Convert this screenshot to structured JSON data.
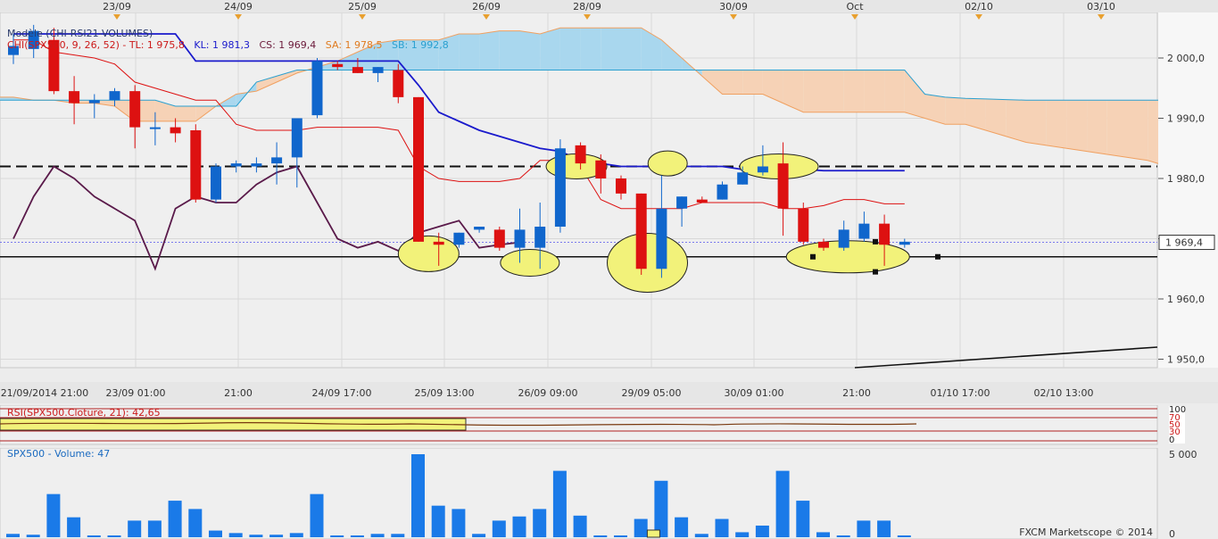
{
  "header": {
    "title_parts": [
      {
        "text": "Modèle (CHI-RSI21-VOLUMES)",
        "color": "#2a3a6a"
      },
      {
        "text": "CHI(SPX500, 9, 26, 52) -  TL: 1 975,8",
        "color": "#cc1a1a"
      },
      {
        "text": "KL: 1 981,3",
        "color": "#1a1acc"
      },
      {
        "text": "CS: 1 969,4",
        "color": "#6b1a3a"
      },
      {
        "text": "SA: 1 978,5",
        "color": "#e07b20"
      },
      {
        "text": "SB: 1 992,8",
        "color": "#2aa0d0"
      }
    ]
  },
  "top_axis_labels": [
    "23/09",
    "24/09",
    "25/09",
    "26/09",
    "28/09",
    "30/09",
    "Oct",
    "02/10",
    "03/10"
  ],
  "bottom_axis_labels": [
    "21/09/2014 21:00",
    "23/09 01:00",
    "21:00",
    "24/09 17:00",
    "25/09 13:00",
    "26/09 09:00",
    "29/09 05:00",
    "30/09 01:00",
    "21:00",
    "01/10 17:00",
    "02/10 13:00"
  ],
  "price_axis_ticks": [
    "2 000,0",
    "1 990,0",
    "1 980,0",
    "1 970,0",
    "1 960,0",
    "1 950,0"
  ],
  "current_price_label": "1 969,4",
  "rsi_panel": {
    "title": "RSI(SPX500.Cloture, 21): 42,65",
    "ticks": [
      "100",
      "70",
      "50",
      "30",
      "0"
    ]
  },
  "volume_panel": {
    "title": "SPX500 - Volume: 47",
    "ticks": [
      "5 000",
      "0"
    ],
    "footer": "FXCM Marketscope © 2014"
  },
  "colors": {
    "bull": "#1066cc",
    "bear": "#dd1111",
    "tenkan": "#dd1111",
    "kijun": "#1a1acc",
    "chikou": "#5a1a4a",
    "kumo_bull": "#a9d7ee",
    "kumo_bear": "#f6d2b6",
    "highlight": "#f2f27a"
  },
  "chart_data": {
    "type": "candlestick",
    "instrument": "SPX500",
    "price_range": [
      1947,
      2005
    ],
    "candles": [
      {
        "o": 2000.5,
        "h": 2004.0,
        "l": 1999.0,
        "c": 2002.0
      },
      {
        "o": 2001.5,
        "h": 2005.5,
        "l": 2000.0,
        "c": 2004.5
      },
      {
        "o": 2003.0,
        "h": 2005.0,
        "l": 1994.0,
        "c": 1994.5
      },
      {
        "o": 1994.5,
        "h": 1997.0,
        "l": 1989.0,
        "c": 1992.5
      },
      {
        "o": 1992.5,
        "h": 1994.0,
        "l": 1990.0,
        "c": 1993.0
      },
      {
        "o": 1993.0,
        "h": 1995.0,
        "l": 1992.0,
        "c": 1994.5
      },
      {
        "o": 1994.5,
        "h": 1995.5,
        "l": 1985.0,
        "c": 1988.5
      },
      {
        "o": 1988.5,
        "h": 1991.0,
        "l": 1985.5,
        "c": 1988.5
      },
      {
        "o": 1988.5,
        "h": 1990.0,
        "l": 1986.0,
        "c": 1987.5
      },
      {
        "o": 1988.0,
        "h": 1989.0,
        "l": 1976.0,
        "c": 1976.5
      },
      {
        "o": 1976.5,
        "h": 1982.5,
        "l": 1976.0,
        "c": 1982.0
      },
      {
        "o": 1982.0,
        "h": 1983.0,
        "l": 1981.0,
        "c": 1982.5
      },
      {
        "o": 1982.0,
        "h": 1983.5,
        "l": 1981.0,
        "c": 1982.5
      },
      {
        "o": 1982.5,
        "h": 1986.0,
        "l": 1979.0,
        "c": 1983.5
      },
      {
        "o": 1983.5,
        "h": 1990.0,
        "l": 1978.5,
        "c": 1990.0
      },
      {
        "o": 1990.5,
        "h": 2000.0,
        "l": 1990.0,
        "c": 1999.5
      },
      {
        "o": 1999.0,
        "h": 1999.5,
        "l": 1998.0,
        "c": 1998.5
      },
      {
        "o": 1998.5,
        "h": 2000.0,
        "l": 1997.5,
        "c": 1997.5
      },
      {
        "o": 1997.5,
        "h": 1998.5,
        "l": 1996.0,
        "c": 1998.5
      },
      {
        "o": 1998.0,
        "h": 1999.0,
        "l": 1992.5,
        "c": 1993.5
      },
      {
        "o": 1993.5,
        "h": 1993.5,
        "l": 1969.5,
        "c": 1969.5
      },
      {
        "o": 1969.5,
        "h": 1971.0,
        "l": 1965.5,
        "c": 1969.0
      },
      {
        "o": 1969.0,
        "h": 1971.0,
        "l": 1968.5,
        "c": 1971.0
      },
      {
        "o": 1971.5,
        "h": 1972.0,
        "l": 1971.0,
        "c": 1972.0
      },
      {
        "o": 1971.5,
        "h": 1972.0,
        "l": 1968.0,
        "c": 1968.5
      },
      {
        "o": 1968.5,
        "h": 1975.0,
        "l": 1966.0,
        "c": 1971.5
      },
      {
        "o": 1968.5,
        "h": 1976.0,
        "l": 1965.0,
        "c": 1972.0
      },
      {
        "o": 1972.0,
        "h": 1986.5,
        "l": 1971.0,
        "c": 1985.0
      },
      {
        "o": 1985.5,
        "h": 1986.0,
        "l": 1981.5,
        "c": 1982.5
      },
      {
        "o": 1983.0,
        "h": 1984.0,
        "l": 1977.5,
        "c": 1980.0
      },
      {
        "o": 1980.0,
        "h": 1980.5,
        "l": 1976.5,
        "c": 1977.5
      },
      {
        "o": 1977.5,
        "h": 1977.5,
        "l": 1964.0,
        "c": 1965.0
      },
      {
        "o": 1965.0,
        "h": 1980.5,
        "l": 1963.5,
        "c": 1975.0
      },
      {
        "o": 1975.0,
        "h": 1977.0,
        "l": 1972.0,
        "c": 1977.0
      },
      {
        "o": 1976.5,
        "h": 1977.0,
        "l": 1976.0,
        "c": 1976.0
      },
      {
        "o": 1976.5,
        "h": 1979.5,
        "l": 1976.5,
        "c": 1979.0
      },
      {
        "o": 1979.0,
        "h": 1982.0,
        "l": 1979.0,
        "c": 1981.0
      },
      {
        "o": 1981.0,
        "h": 1985.5,
        "l": 1980.5,
        "c": 1982.0
      },
      {
        "o": 1982.5,
        "h": 1986.0,
        "l": 1970.5,
        "c": 1975.0
      },
      {
        "o": 1975.0,
        "h": 1976.0,
        "l": 1969.0,
        "c": 1969.5
      },
      {
        "o": 1969.5,
        "h": 1970.0,
        "l": 1968.0,
        "c": 1968.5
      },
      {
        "o": 1968.5,
        "h": 1973.0,
        "l": 1968.0,
        "c": 1971.5
      },
      {
        "o": 1970.0,
        "h": 1974.5,
        "l": 1969.5,
        "c": 1972.5
      },
      {
        "o": 1972.5,
        "h": 1974.0,
        "l": 1965.5,
        "c": 1969.0
      },
      {
        "o": 1969.0,
        "h": 1970.0,
        "l": 1968.5,
        "c": 1969.5
      }
    ],
    "volume_max": 5000,
    "volumes": [
      200,
      150,
      2600,
      1200,
      100,
      100,
      1000,
      1000,
      2200,
      1700,
      400,
      250,
      150,
      150,
      250,
      2600,
      100,
      100,
      200,
      200,
      5000,
      1900,
      1700,
      200,
      1000,
      1250,
      1700,
      4000,
      1300,
      100,
      100,
      1100,
      3400,
      1200,
      200,
      1100,
      300,
      700,
      4000,
      2200,
      300,
      100,
      1000,
      1000,
      50
    ],
    "kijun": [
      2004,
      2004,
      2004,
      2004,
      2004,
      2004,
      2004,
      2004,
      2004,
      1999.5,
      1999.5,
      1999.5,
      1999.5,
      1999.5,
      1999.5,
      1999.5,
      1999.5,
      1999.5,
      1999.5,
      1999.5,
      1995.5,
      1991,
      1989.5,
      1988,
      1987,
      1986,
      1985,
      1984.5,
      1983,
      1982.5,
      1982,
      1982,
      1982,
      1982,
      1982,
      1982,
      1981.5,
      1981.5,
      1981.5,
      1981.5,
      1981.3,
      1981.3,
      1981.3,
      1981.3,
      1981.3
    ],
    "tenkan": [
      2003,
      2003,
      2001,
      2000.5,
      2000,
      1999,
      1996,
      1995,
      1994,
      1993,
      1993,
      1989,
      1988,
      1988,
      1988,
      1988.5,
      1988.5,
      1988.5,
      1988.5,
      1988,
      1982,
      1980,
      1979.5,
      1979.5,
      1979.5,
      1980,
      1983,
      1983,
      1982,
      1976.5,
      1975,
      1975,
      1975,
      1975,
      1976,
      1976,
      1976,
      1976,
      1975,
      1975,
      1975.5,
      1976.5,
      1976.5,
      1975.8,
      1975.8
    ],
    "senkou_a": [
      1993.5,
      1993.5,
      1993,
      1993,
      1992.5,
      1992.5,
      1992,
      1989.5,
      1989.5,
      1989.5,
      1989.5,
      1992,
      1994,
      1994.5,
      1996,
      1997.5,
      1998.5,
      1999.5,
      2001,
      2002.5,
      2003,
      2003,
      2003,
      2004,
      2004,
      2004.5,
      2004.5,
      2004,
      2005,
      2005,
      2005,
      2005,
      2005,
      2003,
      2000,
      1997,
      1994,
      1994,
      1994,
      1992.5,
      1991,
      1991,
      1991,
      1991,
      1991,
      1991,
      1990,
      1989,
      1989,
      1988,
      1987,
      1986,
      1985.5,
      1985,
      1984.5,
      1984,
      1983.5,
      1983,
      1982,
      1980,
      1979
    ],
    "senkou_b": [
      1993,
      1993,
      1993,
      1993,
      1993,
      1993,
      1993,
      1993,
      1993,
      1992,
      1992,
      1992,
      1992,
      1996,
      1997,
      1998,
      1998,
      1998,
      1998,
      1998,
      1998,
      1998,
      1998,
      1998,
      1998,
      1998,
      1998,
      1998,
      1998,
      1998,
      1998,
      1998,
      1998,
      1998,
      1998,
      1998,
      1998,
      1998,
      1998,
      1998,
      1998,
      1998,
      1998,
      1998,
      1998,
      1998,
      1994,
      1993.5,
      1993.3,
      1993.2,
      1993.1,
      1993,
      1993,
      1993,
      1993,
      1993,
      1993,
      1993,
      1993,
      1993,
      1993
    ],
    "chikou": [
      1970,
      1977,
      1982,
      1980,
      1977,
      1975,
      1973,
      1965,
      1975,
      1977,
      1976,
      1976,
      1979,
      1981,
      1982,
      1976,
      1970,
      1968.5,
      1969.5,
      1968,
      1971,
      1972,
      1973,
      1968.5,
      1969,
      1969.4
    ],
    "support_level": 1967,
    "resistance_level": 1982,
    "rsi_value": 42.65
  }
}
